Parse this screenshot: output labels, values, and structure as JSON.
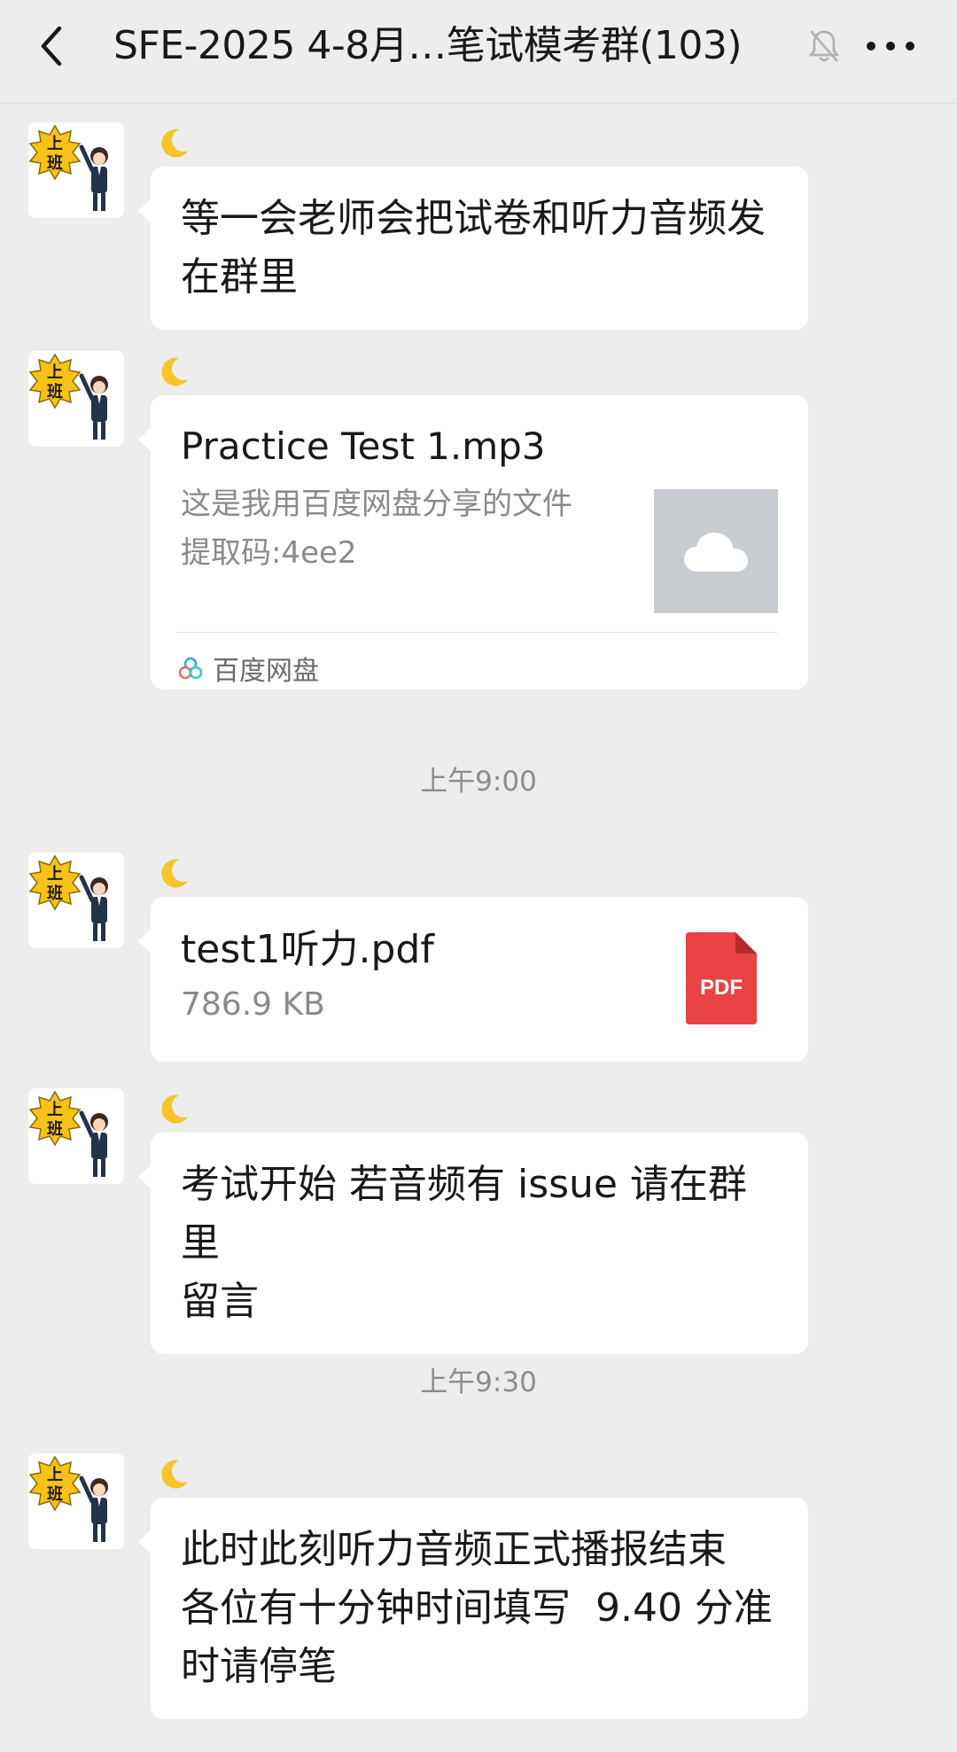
{
  "header": {
    "title": "SFE-2025 4-8月…笔试模考群(103)",
    "back_icon": "chevron-left-icon",
    "mute_icon": "bell-muted-icon",
    "more_icon": "more-icon"
  },
  "avatar": {
    "sticker_text_top": "上",
    "sticker_text_bottom": "班"
  },
  "messages": [
    {
      "type": "text",
      "nickname_icon": "crescent-moon-icon",
      "text": "等一会老师会把试卷和听力音频发\n在群里"
    },
    {
      "type": "link_card",
      "nickname_icon": "crescent-moon-icon",
      "title": "Practice Test 1.mp3",
      "description": "这是我用百度网盘分享的文件\n提取码:4ee2",
      "thumbnail_icon": "cloud-icon",
      "source_icon": "baidu-netdisk-icon",
      "source": "百度网盘"
    },
    {
      "type": "file",
      "nickname_icon": "crescent-moon-icon",
      "file_name": "test1听力.pdf",
      "file_size": "786.9 KB",
      "file_icon_label": "PDF"
    },
    {
      "type": "text",
      "nickname_icon": "crescent-moon-icon",
      "text": "考试开始 若音频有 issue 请在群里\n留言"
    },
    {
      "type": "text",
      "nickname_icon": "crescent-moon-icon",
      "text": "此时此刻听力音频正式播报结束\n各位有十分钟时间填写  9.40 分准\n时请停笔"
    }
  ],
  "timestamps": [
    "上午9:00",
    "上午9:30"
  ],
  "colors": {
    "background": "#ededed",
    "bubble": "#ffffff",
    "pdf_red": "#e94343",
    "sticker_yellow": "#f6c21a"
  }
}
